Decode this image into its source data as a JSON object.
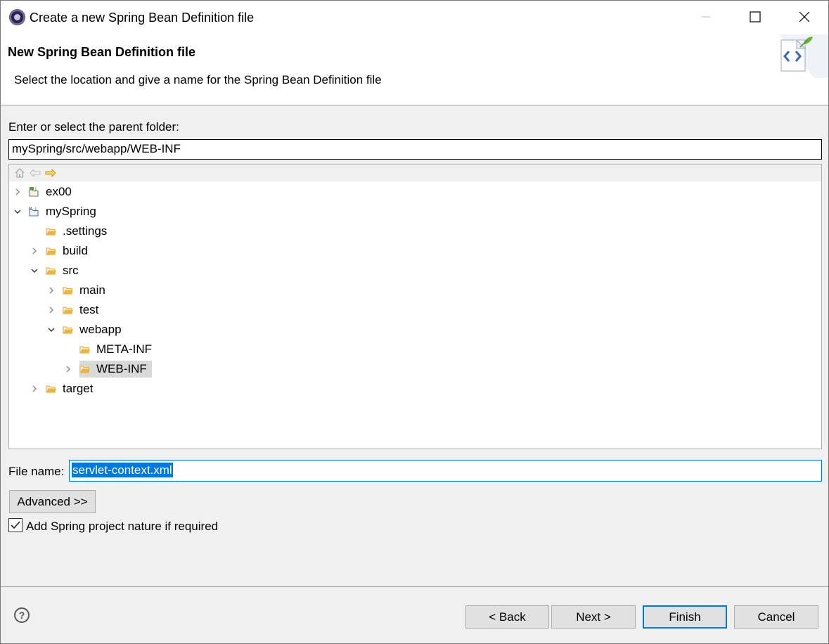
{
  "window": {
    "title": "Create a new Spring Bean Definition file"
  },
  "header": {
    "title": "New Spring Bean Definition file",
    "description": "Select the location and give a name for the Spring Bean Definition file"
  },
  "parent_folder": {
    "label": "Enter or select the parent folder:",
    "value": "mySpring/src/webapp/WEB-INF"
  },
  "tree": {
    "toolbar": [
      "home-icon",
      "back-arrow-icon",
      "forward-arrow-icon"
    ],
    "items": [
      {
        "label": "ex00",
        "depth": 0,
        "state": "collapsed",
        "icon": "java-project-icon"
      },
      {
        "label": "mySpring",
        "depth": 0,
        "state": "expanded",
        "icon": "maven-project-icon"
      },
      {
        "label": ".settings",
        "depth": 1,
        "state": "leaf",
        "icon": "folder-icon"
      },
      {
        "label": "build",
        "depth": 1,
        "state": "collapsed",
        "icon": "folder-icon"
      },
      {
        "label": "src",
        "depth": 1,
        "state": "expanded",
        "icon": "folder-icon"
      },
      {
        "label": "main",
        "depth": 2,
        "state": "collapsed",
        "icon": "folder-icon"
      },
      {
        "label": "test",
        "depth": 2,
        "state": "collapsed",
        "icon": "folder-icon"
      },
      {
        "label": "webapp",
        "depth": 2,
        "state": "expanded",
        "icon": "folder-icon"
      },
      {
        "label": "META-INF",
        "depth": 3,
        "state": "leaf",
        "icon": "folder-icon"
      },
      {
        "label": "WEB-INF",
        "depth": 3,
        "state": "collapsed",
        "icon": "folder-icon",
        "selected": true
      },
      {
        "label": "target",
        "depth": 1,
        "state": "collapsed",
        "icon": "folder-icon"
      }
    ]
  },
  "file_name": {
    "label": "File name:",
    "value": "servlet-context.xml"
  },
  "advanced_button": "Advanced >>",
  "spring_nature": {
    "label": "Add Spring project nature if required",
    "checked": true
  },
  "buttons": {
    "help": "?",
    "back": "< Back",
    "next": "Next >",
    "finish": "Finish",
    "cancel": "Cancel"
  },
  "colors": {
    "accent": "#0078d7",
    "folder": "#e8b44a",
    "selection": "#d9d9d9"
  }
}
